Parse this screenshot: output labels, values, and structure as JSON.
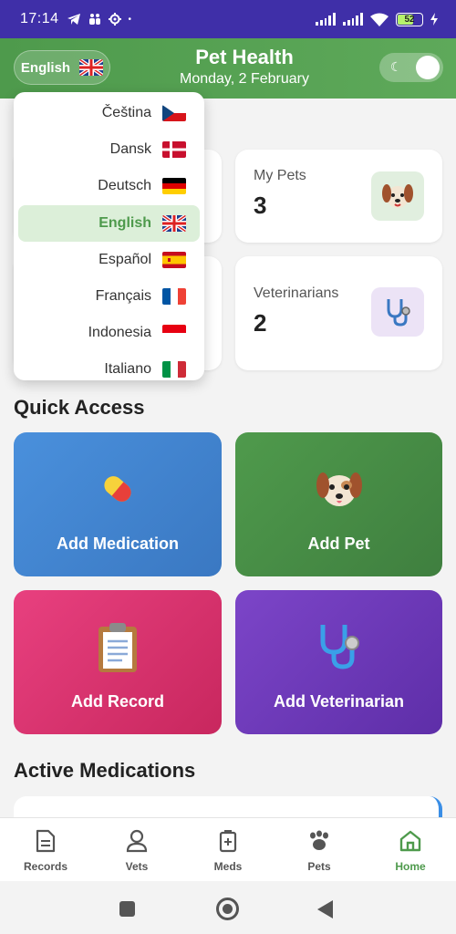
{
  "status_bar": {
    "time": "17:14",
    "battery": "52"
  },
  "header": {
    "language_label": "English",
    "title": "Pet Health",
    "date": "Monday, 2 February"
  },
  "stats": [
    {
      "label": "My Pets",
      "value": "3",
      "icon": "dog-face-icon"
    },
    {
      "label": "Veterinarians",
      "value": "2",
      "icon": "stethoscope-icon"
    }
  ],
  "sections": {
    "quick_access": "Quick Access",
    "active_medications": "Active Medications"
  },
  "quick_access": [
    {
      "label": "Add Medication",
      "icon": "pill-icon",
      "color": "#4a90dc"
    },
    {
      "label": "Add Pet",
      "icon": "dog-face-icon",
      "color": "#4f9a4c"
    },
    {
      "label": "Add Record",
      "icon": "clipboard-icon",
      "color": "#e8407f"
    },
    {
      "label": "Add Veterinarian",
      "icon": "stethoscope-icon",
      "color": "#7c45c8"
    }
  ],
  "languages": [
    {
      "label": "Čeština",
      "flag": "cz"
    },
    {
      "label": "Dansk",
      "flag": "dk"
    },
    {
      "label": "Deutsch",
      "flag": "de"
    },
    {
      "label": "English",
      "flag": "gb",
      "selected": true
    },
    {
      "label": "Español",
      "flag": "es"
    },
    {
      "label": "Français",
      "flag": "fr"
    },
    {
      "label": "Indonesia",
      "flag": "id"
    },
    {
      "label": "Italiano",
      "flag": "it"
    }
  ],
  "bottom_nav": [
    {
      "label": "Records",
      "icon": "document-icon"
    },
    {
      "label": "Vets",
      "icon": "person-icon"
    },
    {
      "label": "Meds",
      "icon": "medicine-box-icon"
    },
    {
      "label": "Pets",
      "icon": "paw-icon"
    },
    {
      "label": "Home",
      "icon": "home-icon",
      "active": true
    }
  ],
  "colors": {
    "primary_green": "#4e9a4c",
    "status_bar": "#3f2fa8"
  }
}
